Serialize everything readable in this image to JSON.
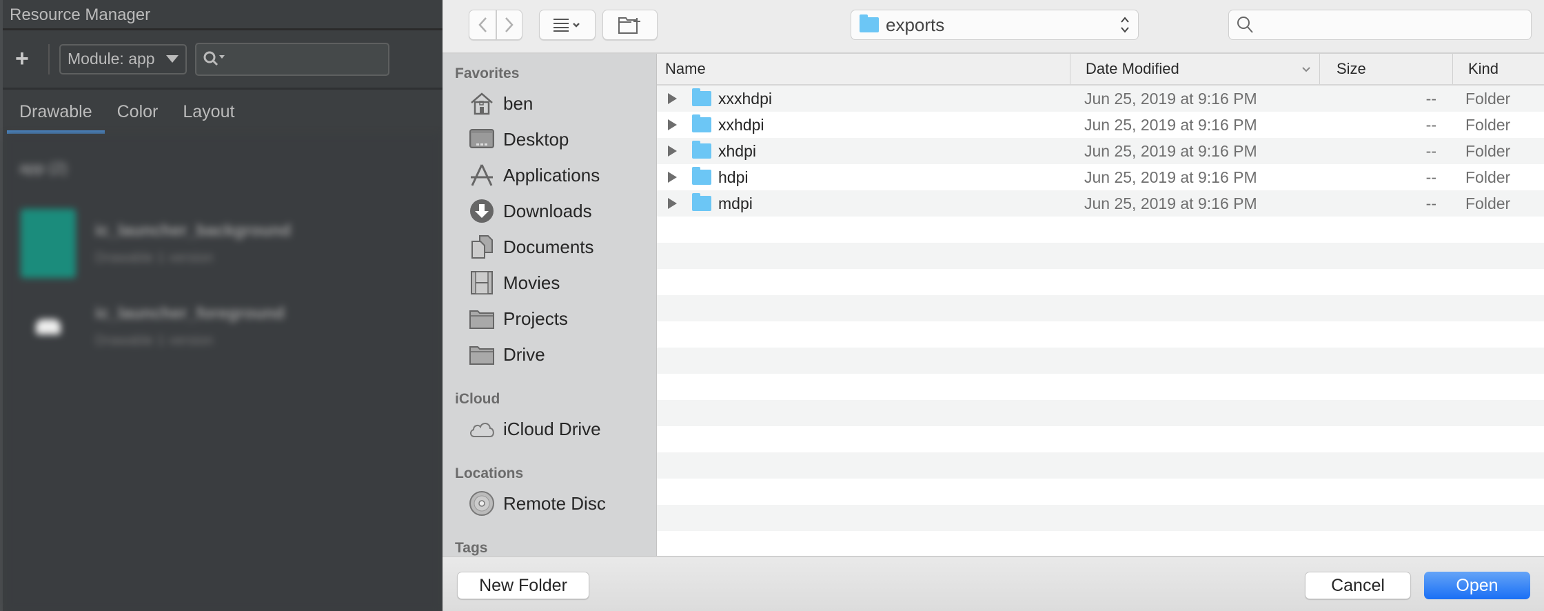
{
  "ide": {
    "title": "Resource Manager",
    "add_label": "+",
    "module_label": "Module: app",
    "search_placeholder": "",
    "tabs": [
      {
        "label": "Drawable",
        "active": true
      },
      {
        "label": "Color",
        "active": false
      },
      {
        "label": "Layout",
        "active": false
      }
    ],
    "group_label": "app (2)",
    "resources": [
      {
        "name": "ic_launcher_background",
        "sub": "Drawable    1 version",
        "thumb_color": "#1b8c7c"
      },
      {
        "name": "ic_launcher_foreground",
        "sub": "Drawable    1 version",
        "thumb_color": "#3a3d40"
      }
    ]
  },
  "dialog": {
    "toolbar": {
      "back_icon": "chevron-left",
      "forward_icon": "chevron-right",
      "view_icon": "list-view",
      "new_folder_icon": "new-folder",
      "location": "exports",
      "search_value": ""
    },
    "sidebar": {
      "sections": [
        {
          "label": "Favorites",
          "items": [
            {
              "label": "ben",
              "icon": "home"
            },
            {
              "label": "Desktop",
              "icon": "desktop"
            },
            {
              "label": "Applications",
              "icon": "applications"
            },
            {
              "label": "Downloads",
              "icon": "downloads"
            },
            {
              "label": "Documents",
              "icon": "documents"
            },
            {
              "label": "Movies",
              "icon": "movies"
            },
            {
              "label": "Projects",
              "icon": "folder"
            },
            {
              "label": "Drive",
              "icon": "folder"
            }
          ]
        },
        {
          "label": "iCloud",
          "items": [
            {
              "label": "iCloud Drive",
              "icon": "cloud"
            }
          ]
        },
        {
          "label": "Locations",
          "items": [
            {
              "label": "Remote Disc",
              "icon": "disc"
            }
          ]
        },
        {
          "label": "Tags",
          "items": []
        }
      ]
    },
    "columns": {
      "name": "Name",
      "date": "Date Modified",
      "size": "Size",
      "kind": "Kind"
    },
    "files": [
      {
        "name": "xxxhdpi",
        "date": "Jun 25, 2019 at 9:16 PM",
        "size": "--",
        "kind": "Folder"
      },
      {
        "name": "xxhdpi",
        "date": "Jun 25, 2019 at 9:16 PM",
        "size": "--",
        "kind": "Folder"
      },
      {
        "name": "xhdpi",
        "date": "Jun 25, 2019 at 9:16 PM",
        "size": "--",
        "kind": "Folder"
      },
      {
        "name": "hdpi",
        "date": "Jun 25, 2019 at 9:16 PM",
        "size": "--",
        "kind": "Folder"
      },
      {
        "name": "mdpi",
        "date": "Jun 25, 2019 at 9:16 PM",
        "size": "--",
        "kind": "Folder"
      }
    ],
    "buttons": {
      "new_folder": "New Folder",
      "cancel": "Cancel",
      "open": "Open"
    },
    "accent": "#1a73f5"
  }
}
